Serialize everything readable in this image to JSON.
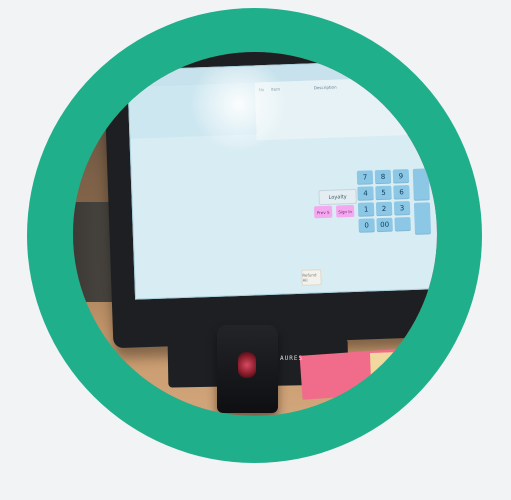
{
  "photo": {
    "scene": "POS terminal with barcode scanner on wooden counter"
  },
  "pos_screen": {
    "header_labels": {
      "no": "No",
      "item": "Item",
      "description": "Description",
      "qty": "Qty"
    },
    "buttons": {
      "loyalty": "Loyalty",
      "pink_1": "Prev S",
      "pink_2": "Sign In",
      "bottom": "Refund All"
    },
    "keypad": [
      "7",
      "8",
      "9",
      "4",
      "5",
      "6",
      "1",
      "2",
      "3",
      "0",
      "00"
    ],
    "enter": ""
  },
  "brand": "AURES"
}
